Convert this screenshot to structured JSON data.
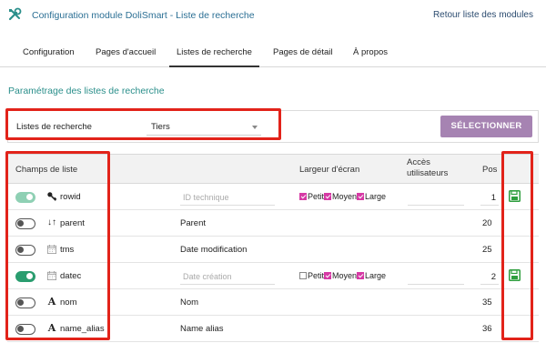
{
  "header": {
    "title": "Configuration module DoliSmart - Liste de recherche",
    "back_link": "Retour liste des modules"
  },
  "tabs": [
    {
      "label": "Configuration",
      "active": false
    },
    {
      "label": "Pages d'accueil",
      "active": false
    },
    {
      "label": "Listes de recherche",
      "active": true
    },
    {
      "label": "Pages de détail",
      "active": false
    },
    {
      "label": "À propos",
      "active": false
    }
  ],
  "section_title": "Paramétrage des listes de recherche",
  "filter": {
    "label": "Listes de recherche",
    "selected": "Tiers",
    "button": "SÉLECTIONNER"
  },
  "table": {
    "headers": {
      "fields": "Champs de liste",
      "width": "Largeur d'écran",
      "access": "Accès\nutilisateurs",
      "position": "Pos"
    },
    "width_options": {
      "small": "Petit",
      "medium": "Moyen",
      "large": "Large"
    },
    "rows": [
      {
        "name": "rowid",
        "type_icon": "key-icon",
        "enabled": "on-light",
        "label_placeholder": "ID technique",
        "label": "",
        "editable": true,
        "small": true,
        "medium": true,
        "large": true,
        "position": "1",
        "saveable": true
      },
      {
        "name": "parent",
        "type_icon": "sort-icon",
        "enabled": "off",
        "label": "Parent",
        "editable": false,
        "position": "20",
        "saveable": false
      },
      {
        "name": "tms",
        "type_icon": "calendar-icon",
        "enabled": "off",
        "label": "Date modification",
        "editable": false,
        "position": "25",
        "saveable": false
      },
      {
        "name": "datec",
        "type_icon": "calendar-icon",
        "enabled": "on",
        "label_placeholder": "Date création",
        "label": "",
        "editable": true,
        "small": false,
        "medium": true,
        "large": true,
        "position": "2",
        "saveable": true
      },
      {
        "name": "nom",
        "type_icon": "text-icon",
        "enabled": "off",
        "label": "Nom",
        "editable": false,
        "position": "35",
        "saveable": false
      },
      {
        "name": "name_alias",
        "type_icon": "text-icon",
        "enabled": "off",
        "label": "Name alias",
        "editable": false,
        "position": "36",
        "saveable": false
      }
    ]
  },
  "colors": {
    "accent": "#2b8f8b",
    "button": "#a683b2",
    "highlight_border": "#e2231a",
    "toggle_on": "#2a9d6f",
    "save_icon": "#2e9e3e"
  }
}
